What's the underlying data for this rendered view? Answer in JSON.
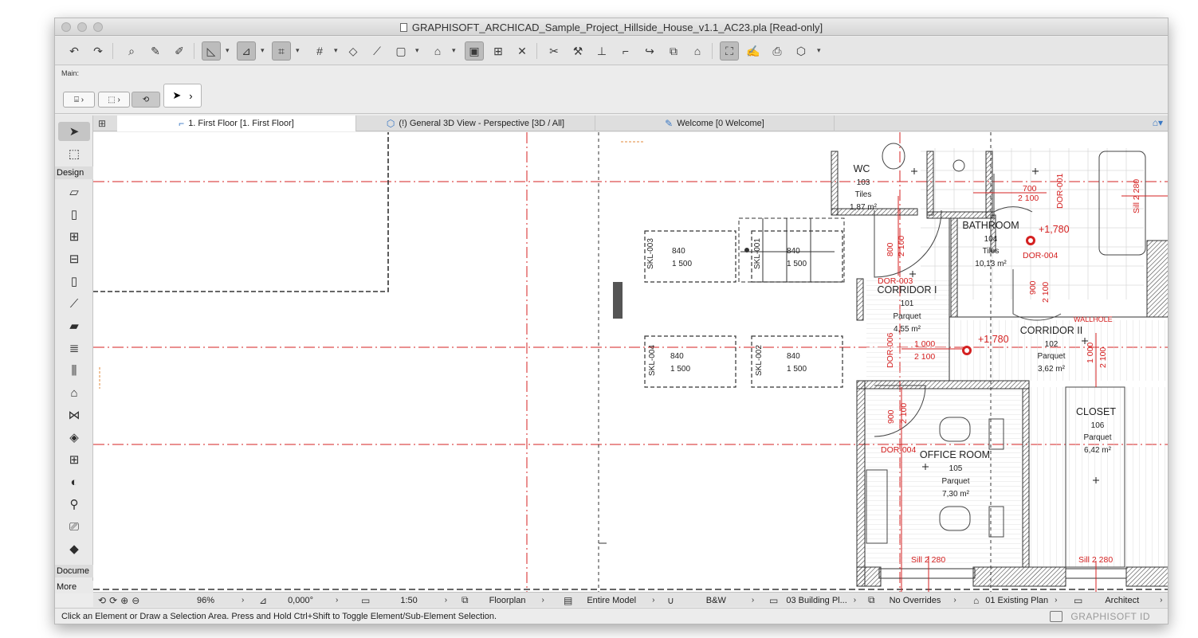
{
  "window": {
    "title": "GRAPHISOFT_ARCHICAD_Sample_Project_Hillside_House_v1.1_AC23.pla [Read-only]"
  },
  "infobox": {
    "main_label": "Main:"
  },
  "toolbox": {
    "design_label": "Design",
    "document_label": "Docume",
    "more_label": "More"
  },
  "tabs": [
    {
      "label": "1. First Floor [1. First Floor]",
      "icon": "floorplan-icon"
    },
    {
      "label": "(!) General 3D View - Perspective [3D / All]",
      "icon": "3d-icon"
    },
    {
      "label": "Welcome [0 Welcome]",
      "icon": "welcome-icon"
    }
  ],
  "plan": {
    "rooms": [
      {
        "name": "WC",
        "number": "103",
        "finish": "Tiles",
        "area": "1,87 m²"
      },
      {
        "name": "BATHROOM",
        "number": "104",
        "finish": "Tiles",
        "area": "10,13 m²"
      },
      {
        "name": "CORRIDOR I",
        "number": "101",
        "finish": "Parquet",
        "area": "4,55 m²"
      },
      {
        "name": "CORRIDOR II",
        "number": "102",
        "finish": "Parquet",
        "area": "3,62 m²"
      },
      {
        "name": "CLOSET",
        "number": "106",
        "finish": "Parquet",
        "area": "6,42 m²"
      },
      {
        "name": "OFFICE ROOM",
        "number": "105",
        "finish": "Parquet",
        "area": "7,30 m²"
      }
    ],
    "skylights": [
      {
        "id": "SKL-003",
        "w": "840",
        "h": "1 500"
      },
      {
        "id": "SKL-001",
        "w": "840",
        "h": "1 500"
      },
      {
        "id": "SKL-004",
        "w": "840",
        "h": "1 500"
      },
      {
        "id": "SKL-002",
        "w": "840",
        "h": "1 500"
      }
    ],
    "doors": [
      "DOR-003",
      "DOR-004",
      "DOR-006",
      "DOR-004",
      "DOR-001"
    ],
    "dims": {
      "d800": "800",
      "d2100": "2 100",
      "d900": "900",
      "d1000": "1 000",
      "d700": "700",
      "level": "+1,780",
      "wallhole": "WALLHOLE",
      "sill": "Sill 2 280"
    }
  },
  "statusbar": {
    "zoom": "96%",
    "angle": "0,000°",
    "scale": "1:50",
    "structure": "Floorplan",
    "model": "Entire Model",
    "pen": "B&W",
    "view": "03 Building Pl...",
    "overrides": "No Overrides",
    "renovation": "01 Existing Plan",
    "role": "Architect"
  },
  "prompt": {
    "text": "Click an Element or Draw a Selection Area. Press and Hold Ctrl+Shift to Toggle Element/Sub-Element Selection.",
    "brand": "GRAPHISOFT ID"
  },
  "colors": {
    "red_annotation": "#d42020",
    "wall_fill": "#6f6f6f",
    "accent_blue": "#3a78c4"
  }
}
